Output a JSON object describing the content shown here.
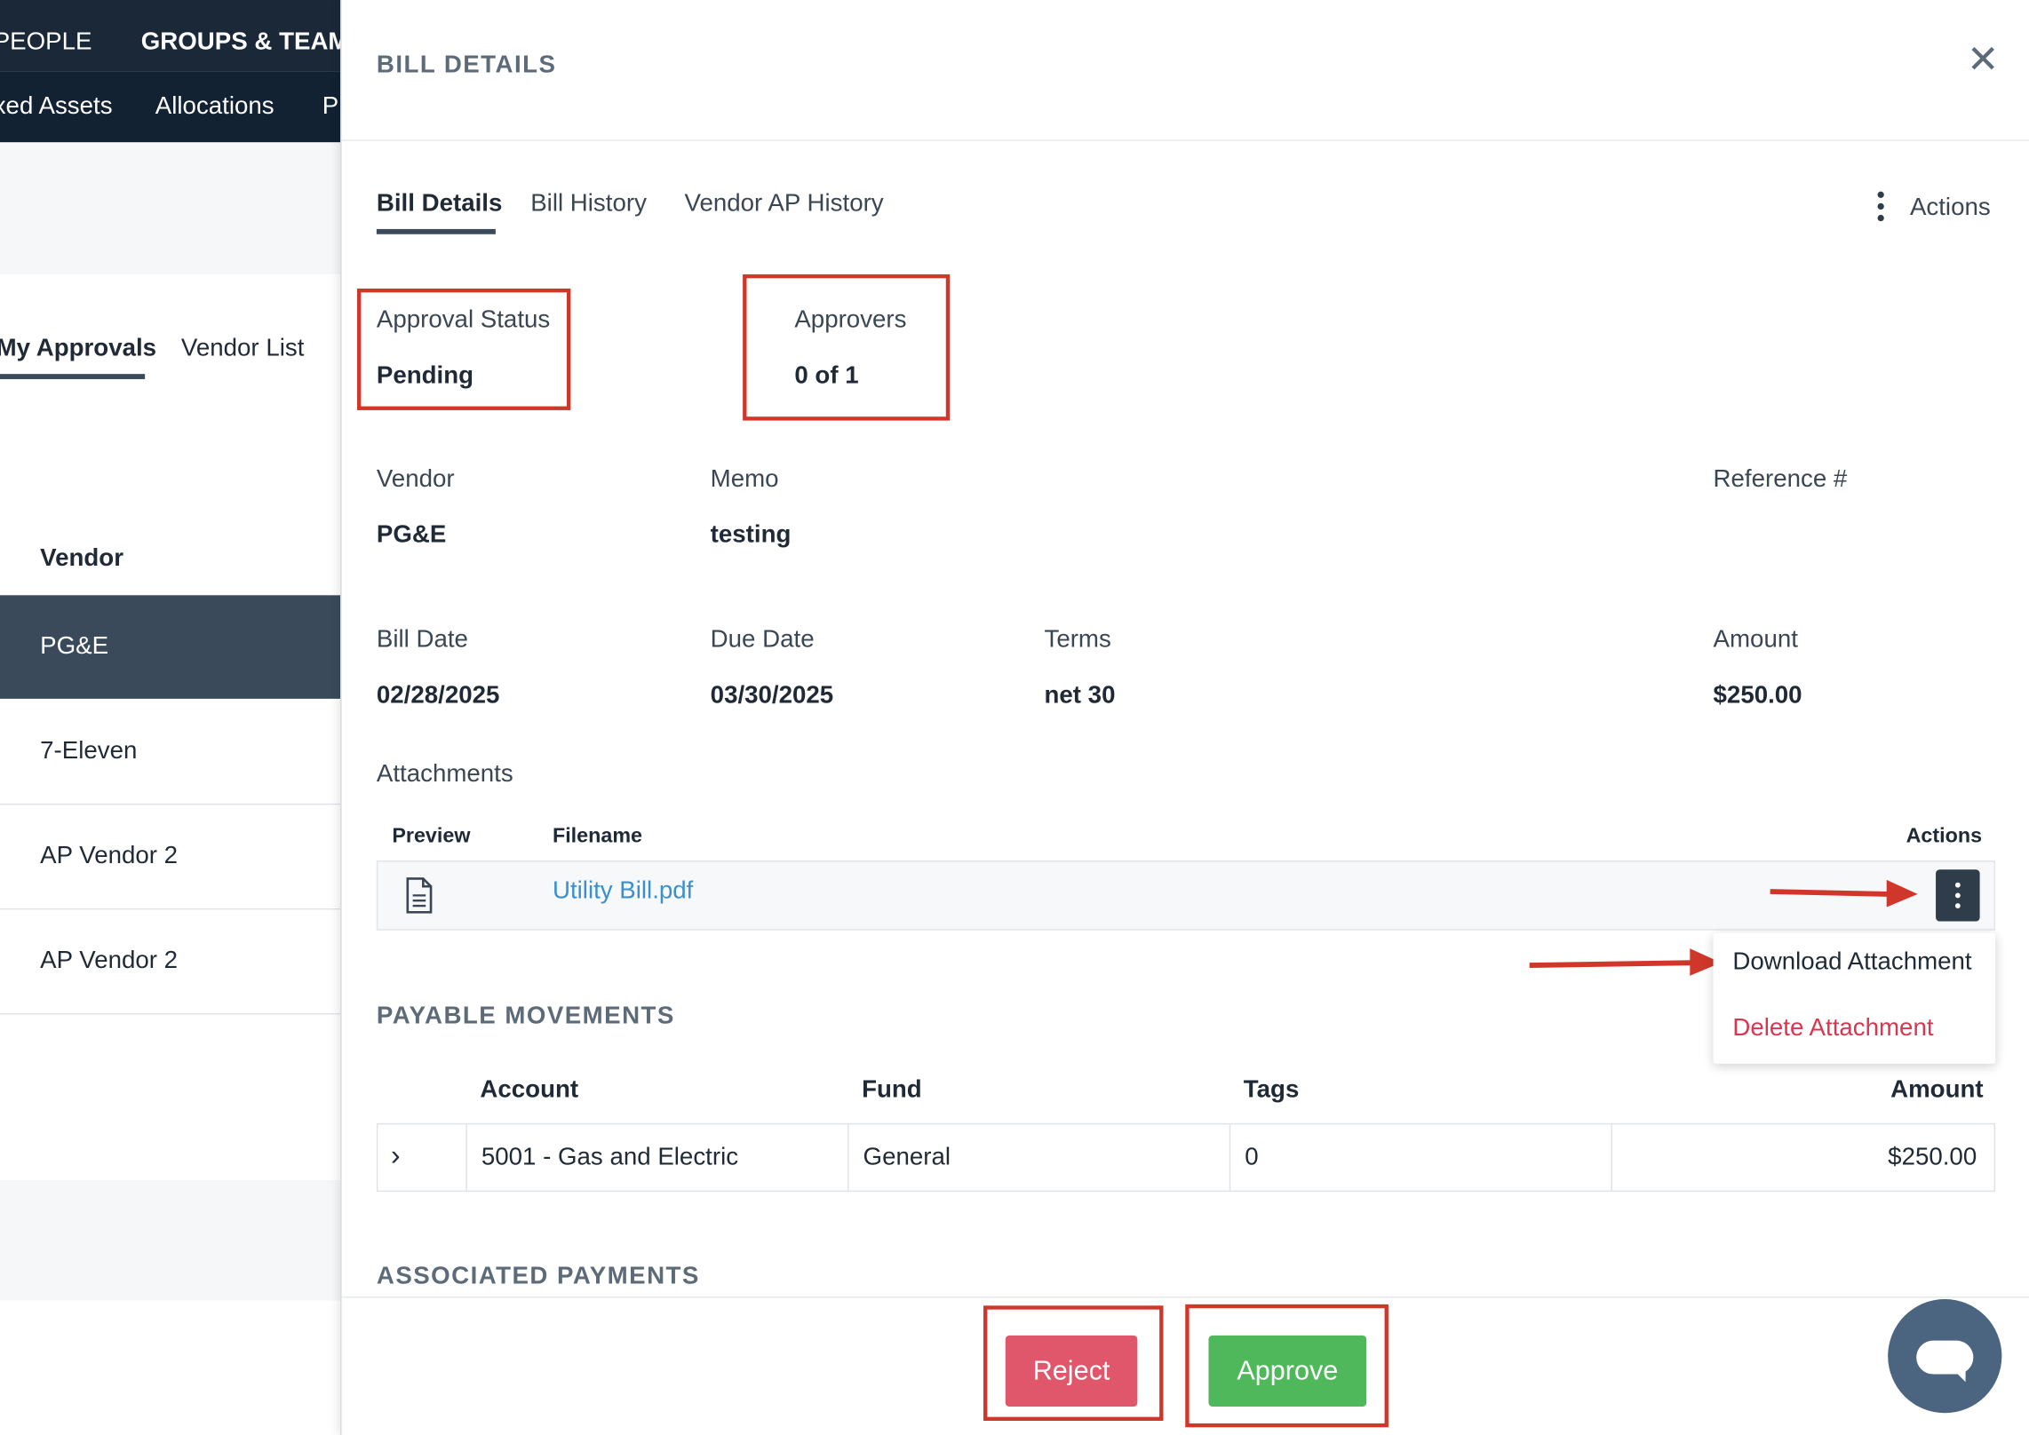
{
  "topnav": {
    "row1": [
      "PEOPLE",
      "GROUPS & TEAMS"
    ],
    "row2": [
      "xed Assets",
      "Allocations",
      "P"
    ]
  },
  "left_pane": {
    "tabs": [
      "My Approvals",
      "Vendor List"
    ],
    "column_header": "Vendor",
    "vendors": [
      "PG&E",
      "7-Eleven",
      "AP Vendor 2",
      "AP Vendor 2"
    ]
  },
  "panel": {
    "title": "BILL DETAILS",
    "tabs": [
      "Bill Details",
      "Bill History",
      "Vendor AP History"
    ],
    "actions_label": "Actions",
    "approval_status": {
      "label": "Approval Status",
      "value": "Pending"
    },
    "approvers": {
      "label": "Approvers",
      "value": "0 of 1"
    },
    "fields": {
      "vendor": {
        "label": "Vendor",
        "value": "PG&E"
      },
      "memo": {
        "label": "Memo",
        "value": "testing"
      },
      "reference": {
        "label": "Reference #",
        "value": ""
      },
      "bill_date": {
        "label": "Bill Date",
        "value": "02/28/2025"
      },
      "due_date": {
        "label": "Due Date",
        "value": "03/30/2025"
      },
      "terms": {
        "label": "Terms",
        "value": "net 30"
      },
      "amount": {
        "label": "Amount",
        "value": "$250.00"
      }
    },
    "attachments": {
      "heading": "Attachments",
      "columns": [
        "Preview",
        "Filename",
        "Actions"
      ],
      "file": "Utility Bill.pdf",
      "menu": [
        "Download Attachment",
        "Delete Attachment"
      ]
    },
    "payable_movements": {
      "heading": "PAYABLE MOVEMENTS",
      "columns": [
        "Account",
        "Fund",
        "Tags",
        "Amount"
      ],
      "row": {
        "expand": "›",
        "account": "5001 - Gas and Electric",
        "fund": "General",
        "tags": "0",
        "amount": "$250.00"
      }
    },
    "associated_payments": {
      "heading": "ASSOCIATED PAYMENTS"
    },
    "footer": {
      "reject": "Reject",
      "approve": "Approve"
    }
  },
  "colors": {
    "nav_bg": "#1b2838",
    "accent_dark": "#3b4a5a",
    "annotation_red": "#d0372b",
    "reject": "#e0566a",
    "approve": "#4fb85b",
    "link": "#3a8fd0",
    "danger_text": "#d9364f",
    "chat": "#4b6580"
  },
  "icons": [
    "close-icon",
    "kebab-icon",
    "document-icon",
    "chevron-right-icon",
    "chat-icon",
    "annotation-arrow"
  ]
}
